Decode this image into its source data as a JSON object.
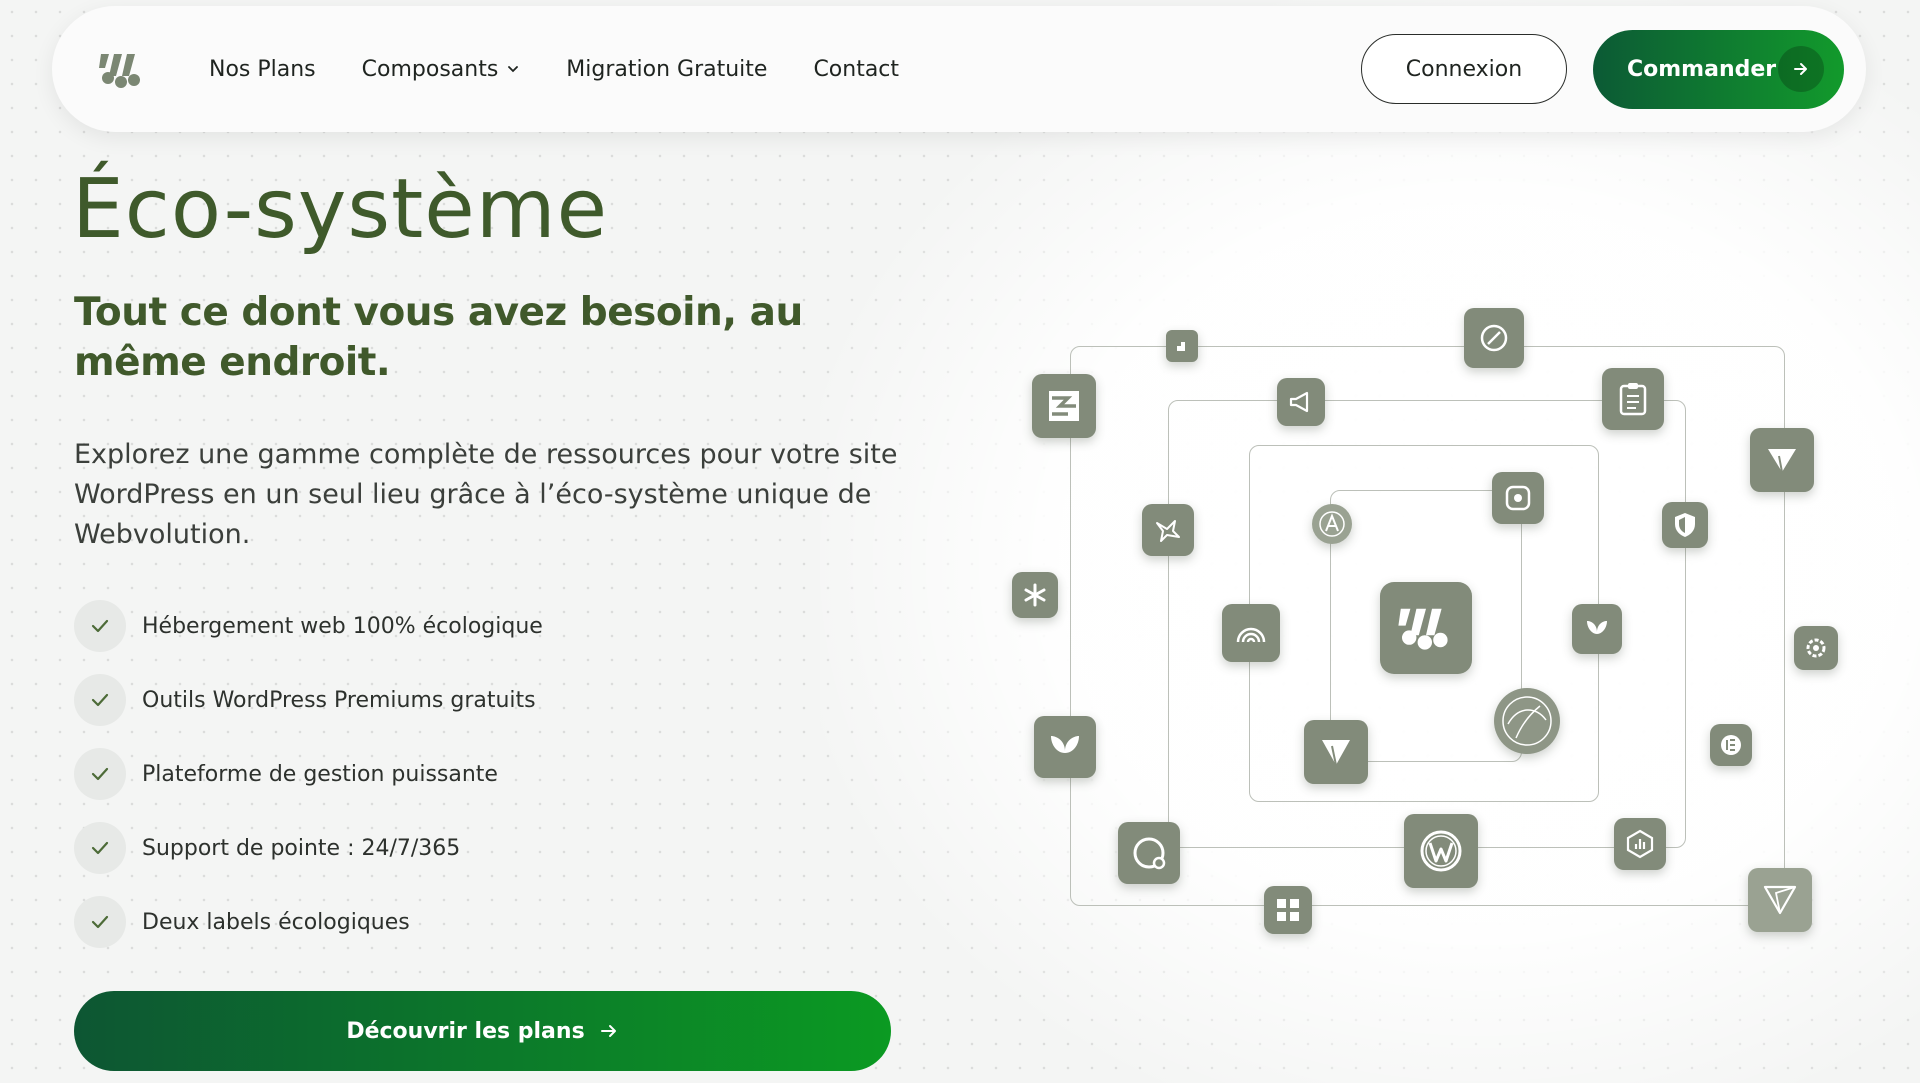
{
  "brand": {
    "logo_icon": "webvolution-logo-icon"
  },
  "nav": {
    "links": [
      "Nos Plans",
      "Composants",
      "Migration Gratuite",
      "Contact"
    ],
    "login": "Connexion",
    "order": "Commander"
  },
  "hero": {
    "title": "Éco-système",
    "subtitle": "Tout ce dont vous avez besoin, au même endroit.",
    "description": "Explorez une gamme complète de ressources pour votre site WordPress en un seul lieu grâce à l’éco-système unique de Webvolution.",
    "features": [
      "Hébergement web 100% écologique",
      "Outils WordPress Premiums gratuits",
      "Plateforme de gestion puissante",
      "Support de pointe : 24/7/365",
      "Deux labels écologiques"
    ],
    "cta": "Découvrir les plans"
  },
  "colors": {
    "accent_dark": "#0c5a35",
    "accent_light": "#129a2c",
    "title": "#3f5a2b",
    "icon_tile": "#828b7a"
  },
  "icons": [
    "webvolution-center-icon",
    "rank-icon",
    "speed-icon",
    "clipboard-icon",
    "megaphone-icon",
    "slider-logo-icon",
    "send-icon",
    "bird-icon",
    "accessibility-icon",
    "camera-icon",
    "shield-icon",
    "asterisk-icon",
    "wifi-icon",
    "leaf-icon",
    "gear-icon",
    "plant-icon",
    "paper-plane-icon",
    "globe-leaf-icon",
    "elementor-icon",
    "chat-icon",
    "wordpress-icon",
    "analytics-icon",
    "gallery-icon",
    "plane-outline-icon"
  ]
}
